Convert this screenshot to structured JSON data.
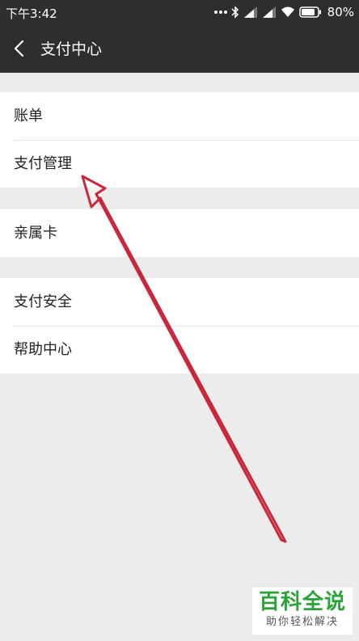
{
  "status_bar": {
    "time": "下午3:42",
    "battery": "80%",
    "icons": [
      "dots-icon",
      "bluetooth-icon",
      "signal-icon",
      "signal-icon",
      "wifi-icon",
      "battery-icon"
    ]
  },
  "nav": {
    "title": "支付中心",
    "back_icon": "chevron-left-icon"
  },
  "groups": [
    {
      "items": [
        "账单",
        "支付管理"
      ]
    },
    {
      "items": [
        "亲属卡"
      ]
    },
    {
      "items": [
        "支付安全",
        "帮助中心"
      ]
    }
  ],
  "annotation": {
    "type": "arrow",
    "color": "#c8283a"
  },
  "watermark": {
    "title": "百科全说",
    "subtitle": "助你轻松解决",
    "color": "#2aa33a"
  }
}
